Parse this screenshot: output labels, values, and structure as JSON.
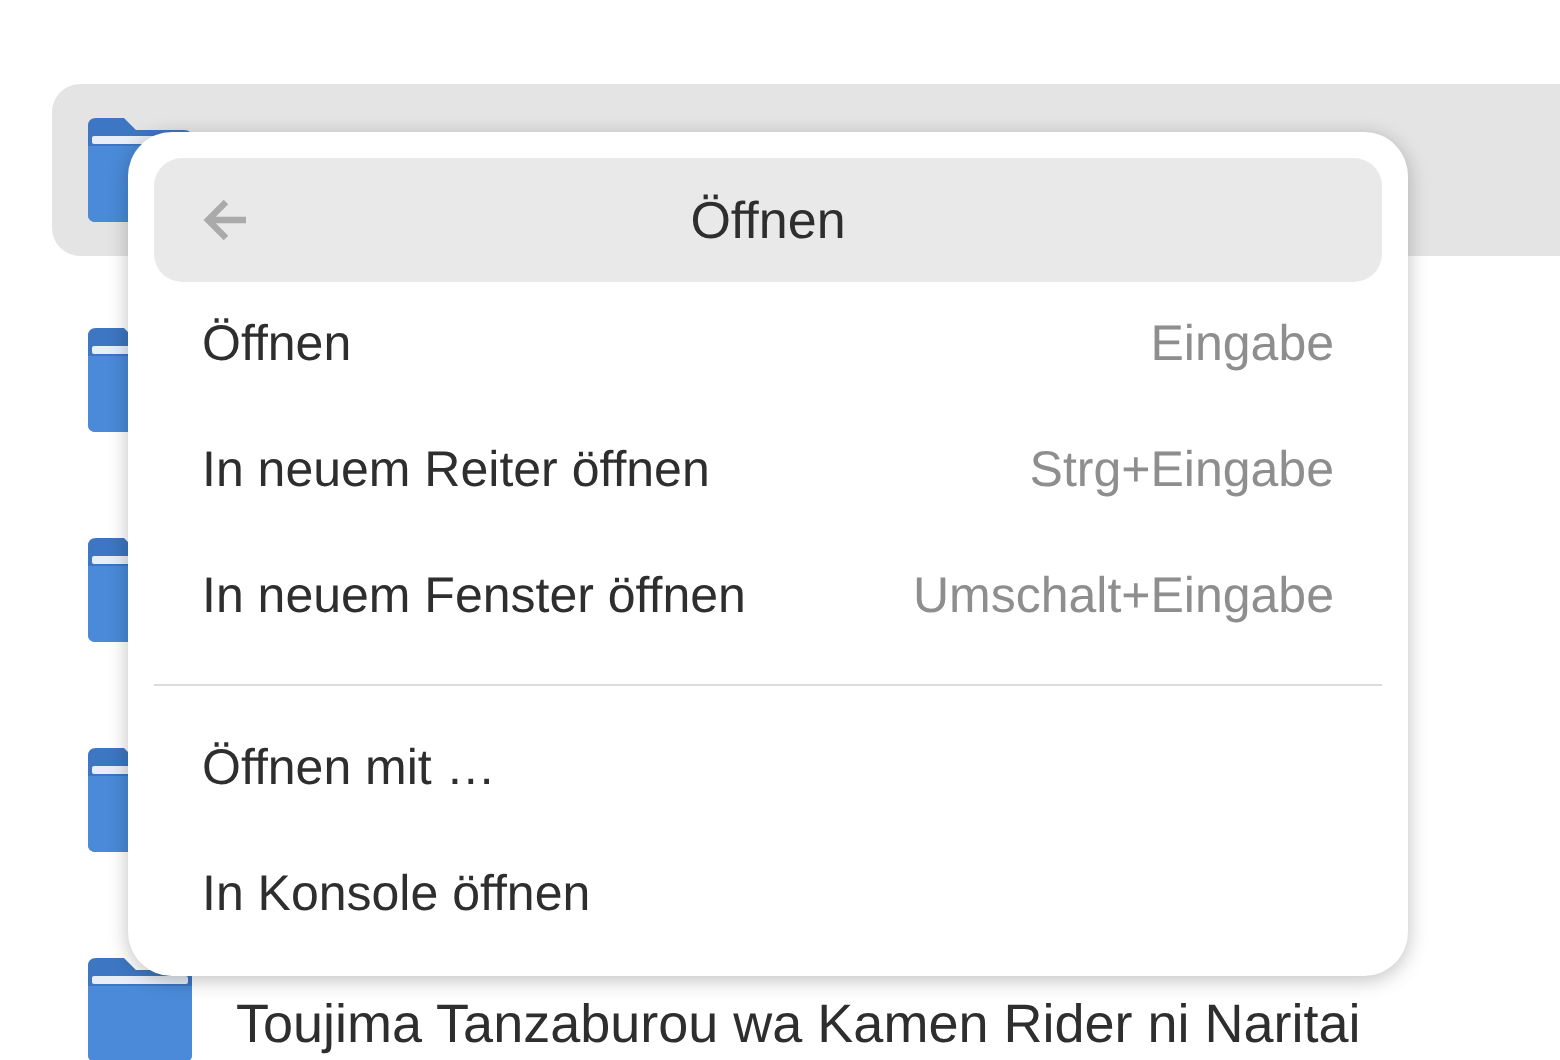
{
  "files": [
    {
      "selected": true
    },
    {
      "selected": false
    },
    {
      "selected": false
    },
    {
      "selected": false
    },
    {
      "selected": false,
      "name": "Toujima Tanzaburou wa Kamen Rider ni Naritai"
    }
  ],
  "menu": {
    "title": "Öffnen",
    "sections": [
      [
        {
          "label": "Öffnen",
          "shortcut": "Eingabe"
        },
        {
          "label": "In neuem Reiter öffnen",
          "shortcut": "Strg+Eingabe"
        },
        {
          "label": "In neuem Fenster öffnen",
          "shortcut": "Umschalt+Eingabe"
        }
      ],
      [
        {
          "label": "Öffnen mit …"
        },
        {
          "label": "In Konsole öffnen"
        }
      ]
    ]
  }
}
